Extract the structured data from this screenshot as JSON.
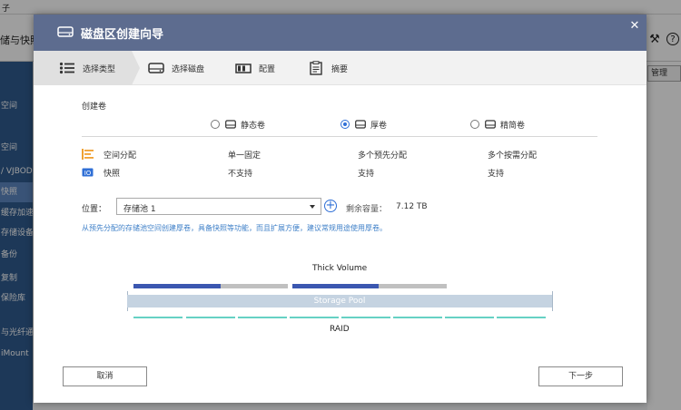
{
  "background": {
    "topbar_text": "子",
    "header_title": "储与快照",
    "sidebar": [
      "空间",
      "空间",
      "/ VJBOD",
      "快照",
      "缓存加速",
      "存储设备",
      "备份",
      "复制",
      "保险库",
      "与光纤通",
      "iMount"
    ],
    "manage_button": "管理"
  },
  "dialog": {
    "title": "磁盘区创建向导",
    "steps": [
      "选择类型",
      "选择磁盘",
      "配置",
      "摘要"
    ],
    "section_label": "创建卷",
    "volume_types": [
      {
        "label": "静态卷",
        "selected": false
      },
      {
        "label": "厚卷",
        "selected": true
      },
      {
        "label": "精简卷",
        "selected": false
      }
    ],
    "features": [
      {
        "name": "空间分配",
        "static": "单一固定",
        "thick": "多个预先分配",
        "thin": "多个按需分配",
        "icon": "allocation-icon"
      },
      {
        "name": "快照",
        "static": "不支持",
        "thick": "支持",
        "thin": "支持",
        "icon": "snapshot-icon"
      }
    ],
    "location_label": "位置：",
    "location_value": "存储池 1",
    "remaining_label": "剩余容量：",
    "remaining_value": "7.12 TB",
    "hint": "从预先分配的存储池空间创建厚卷，具备快照等功能，而且扩展方便，建议常规用途使用厚卷。",
    "diagram": {
      "volume_label": "Thick Volume",
      "pool_label": "Storage Pool",
      "raid_label": "RAID"
    },
    "cancel_button": "取消",
    "next_button": "下一步"
  },
  "colors": {
    "title_bar": "#5d6c8f",
    "accent": "#2f6fd6",
    "volume_used": "#3b57b0",
    "volume_free": "#c0c0c0",
    "pool": "#c5d3e1",
    "raid": "#66d1c4",
    "hint": "#3f80c8"
  }
}
